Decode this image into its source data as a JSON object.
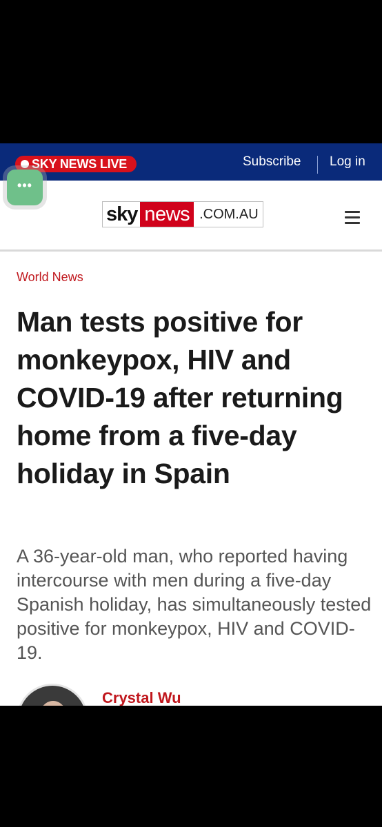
{
  "topbar": {
    "live_label": "SKY NEWS LIVE",
    "subscribe_label": "Subscribe",
    "login_label": "Log in"
  },
  "floating_button": {
    "label": "•••"
  },
  "logo": {
    "sky": "sky",
    "news": "news",
    "domain": ".COM.AU"
  },
  "article": {
    "category": "World News",
    "headline": "Man tests positive for monkeypox, HIV and COVID-19 after returning home from a five-day holiday in Spain",
    "standfirst": "A 36-year-old man, who reported having intercourse with men during a five-day Spanish holiday, has simultaneously tested positive for monkeypox, HIV and COVID-19.",
    "author": "Crystal Wu"
  },
  "colors": {
    "topbar": "#0a2a7a",
    "brand_red": "#d0021b",
    "category_red": "#c0171d",
    "floating_button": "#6fc08a"
  },
  "icons": [
    "live-dot-icon",
    "more-dots-icon",
    "menu-icon"
  ]
}
